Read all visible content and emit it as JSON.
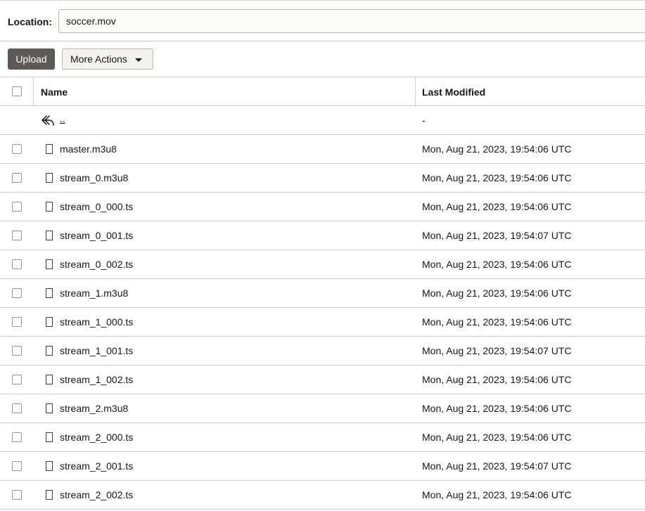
{
  "location": {
    "label": "Location:",
    "value": "soccer.mov"
  },
  "toolbar": {
    "upload_label": "Upload",
    "more_actions_label": "More Actions"
  },
  "table": {
    "columns": {
      "name": "Name",
      "last_modified": "Last Modified"
    },
    "parent_row": {
      "name": "..",
      "last_modified": "-",
      "icon": "undo-arrow-icon"
    },
    "rows": [
      {
        "name": "master.m3u8",
        "last_modified": "Mon, Aug 21, 2023, 19:54:06 UTC"
      },
      {
        "name": "stream_0.m3u8",
        "last_modified": "Mon, Aug 21, 2023, 19:54:06 UTC"
      },
      {
        "name": "stream_0_000.ts",
        "last_modified": "Mon, Aug 21, 2023, 19:54:06 UTC"
      },
      {
        "name": "stream_0_001.ts",
        "last_modified": "Mon, Aug 21, 2023, 19:54:07 UTC"
      },
      {
        "name": "stream_0_002.ts",
        "last_modified": "Mon, Aug 21, 2023, 19:54:06 UTC"
      },
      {
        "name": "stream_1.m3u8",
        "last_modified": "Mon, Aug 21, 2023, 19:54:06 UTC"
      },
      {
        "name": "stream_1_000.ts",
        "last_modified": "Mon, Aug 21, 2023, 19:54:06 UTC"
      },
      {
        "name": "stream_1_001.ts",
        "last_modified": "Mon, Aug 21, 2023, 19:54:07 UTC"
      },
      {
        "name": "stream_1_002.ts",
        "last_modified": "Mon, Aug 21, 2023, 19:54:06 UTC"
      },
      {
        "name": "stream_2.m3u8",
        "last_modified": "Mon, Aug 21, 2023, 19:54:06 UTC"
      },
      {
        "name": "stream_2_000.ts",
        "last_modified": "Mon, Aug 21, 2023, 19:54:06 UTC"
      },
      {
        "name": "stream_2_001.ts",
        "last_modified": "Mon, Aug 21, 2023, 19:54:07 UTC"
      },
      {
        "name": "stream_2_002.ts",
        "last_modified": "Mon, Aug 21, 2023, 19:54:06 UTC"
      }
    ]
  },
  "colors": {
    "upload_button_bg": "#5f5955",
    "border": "#d0cdc8",
    "text": "#161513"
  }
}
